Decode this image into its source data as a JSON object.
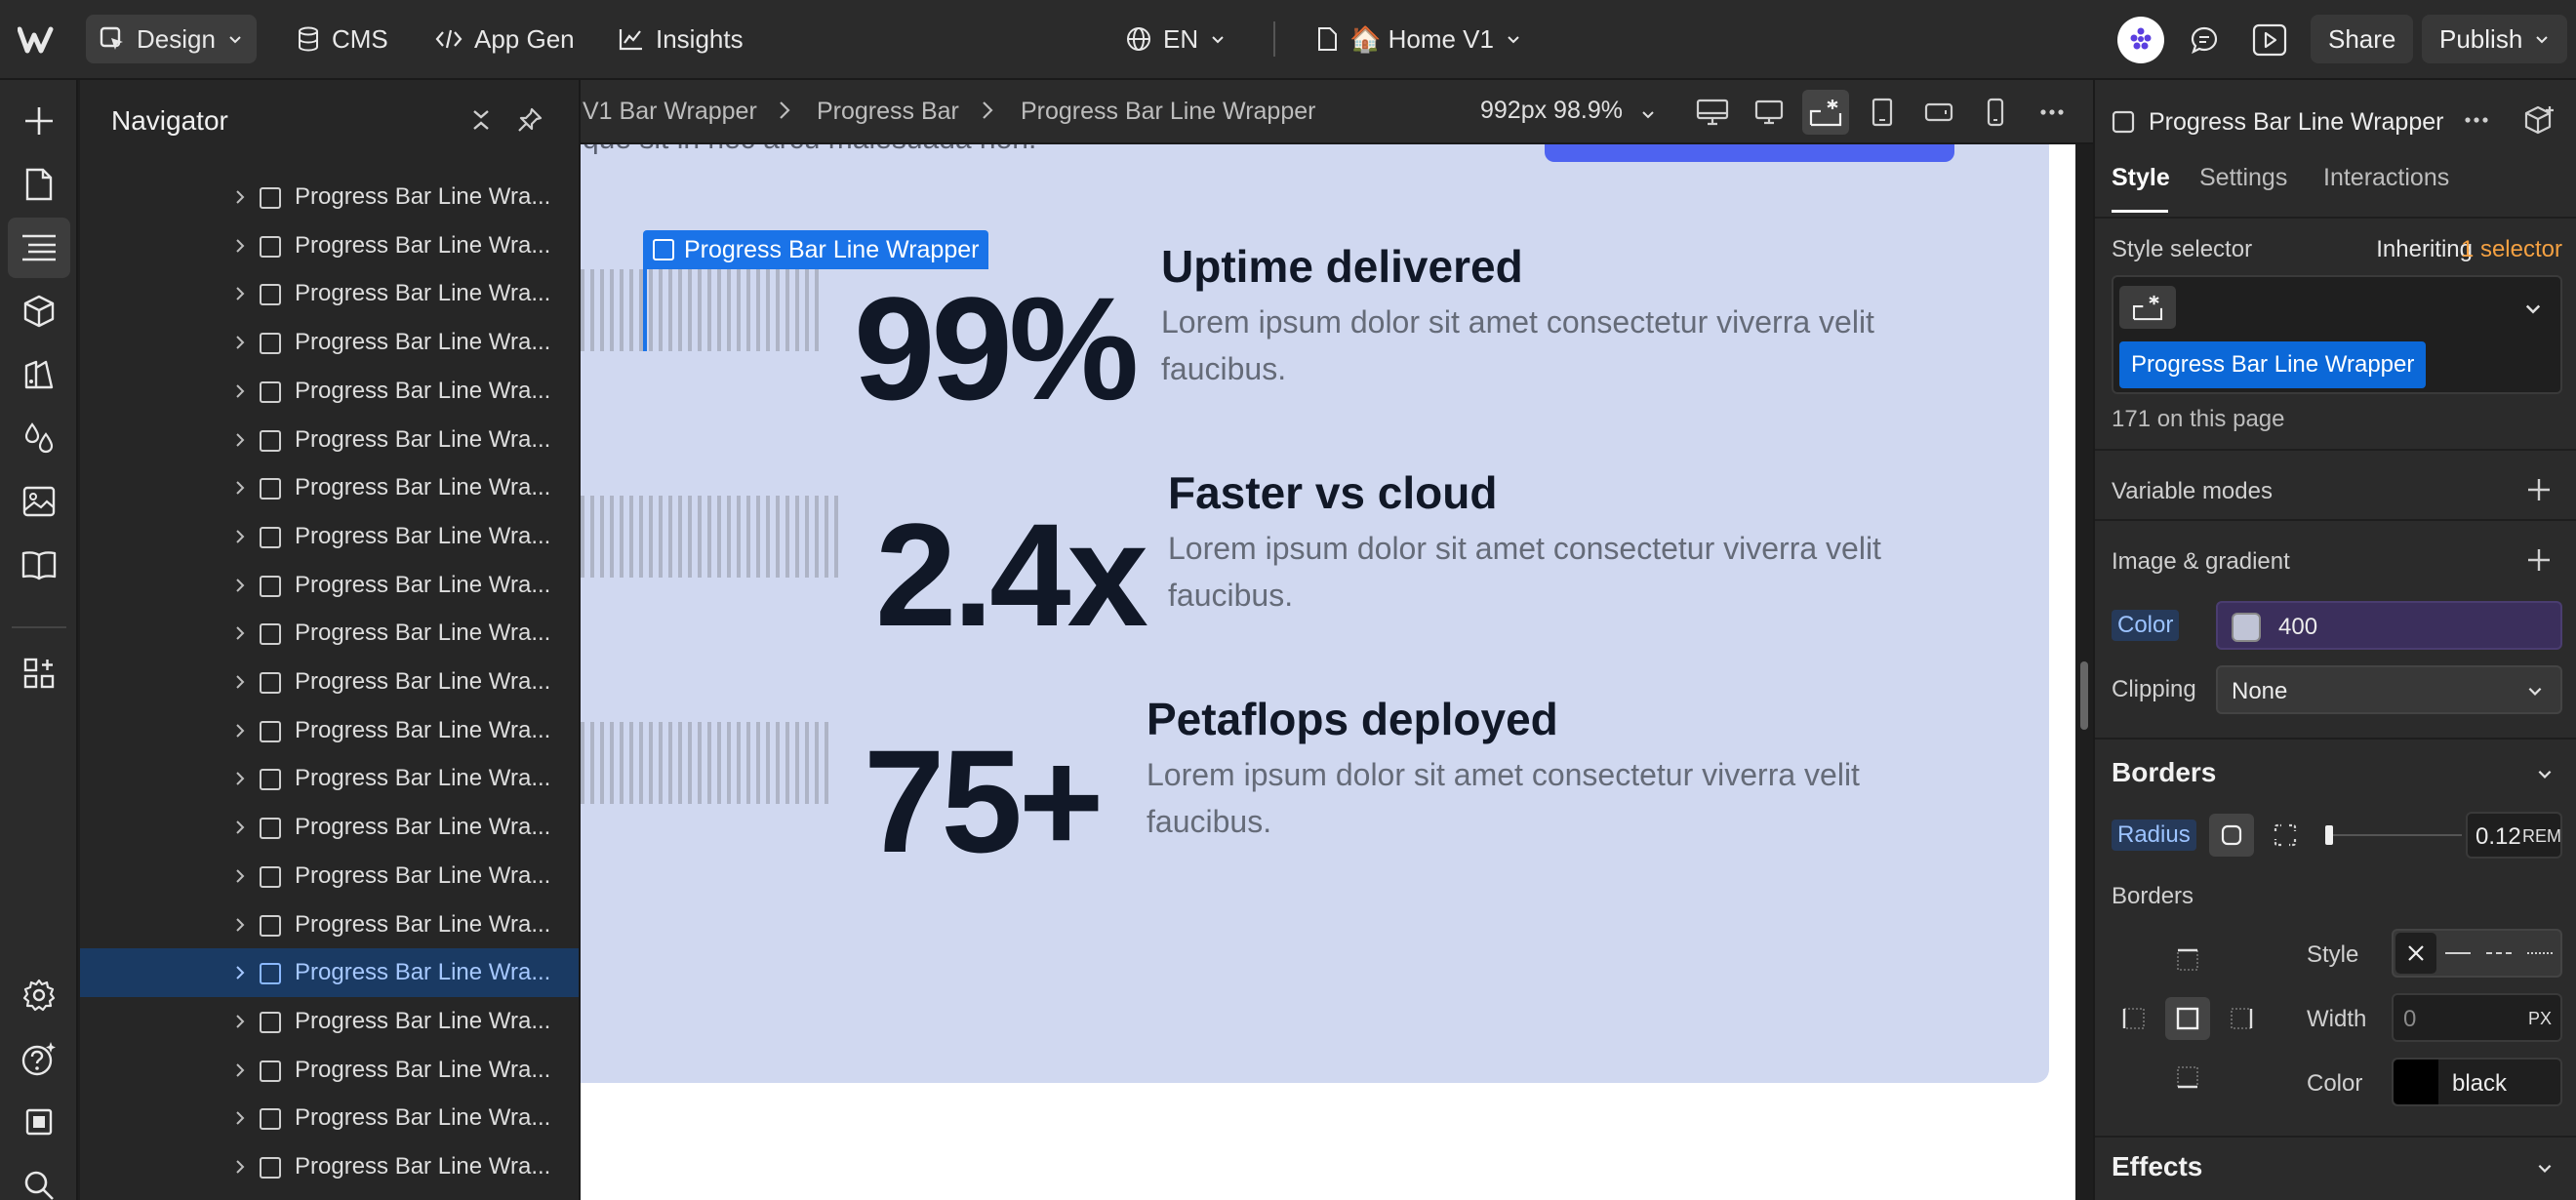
{
  "topbar": {
    "mode": "Design",
    "cms": "CMS",
    "app_gen": "App Gen",
    "insights": "Insights",
    "language": "EN",
    "page_name": "🏠 Home V1",
    "share": "Share",
    "publish": "Publish"
  },
  "navigator": {
    "title": "Navigator",
    "items": [
      "Progress Bar Line Wra...",
      "Progress Bar Line Wra...",
      "Progress Bar Line Wra...",
      "Progress Bar Line Wra...",
      "Progress Bar Line Wra...",
      "Progress Bar Line Wra...",
      "Progress Bar Line Wra...",
      "Progress Bar Line Wra...",
      "Progress Bar Line Wra...",
      "Progress Bar Line Wra...",
      "Progress Bar Line Wra...",
      "Progress Bar Line Wra...",
      "Progress Bar Line Wra...",
      "Progress Bar Line Wra...",
      "Progress Bar Line Wra...",
      "Progress Bar Line Wra...",
      "Progress Bar Line Wra...",
      "Progress Bar Line Wra...",
      "Progress Bar Line Wra...",
      "Progress Bar Line Wra...",
      "Progress Bar Line Wra..."
    ],
    "selected_index": 16
  },
  "canvas": {
    "breadcrumbs": [
      "V1 Bar Wrapper",
      "Progress Bar",
      "Progress Bar Line Wrapper"
    ],
    "breakpoint_info": "992px 98.9%",
    "cut_text": "que sit in nec arcu malesuada non.",
    "selected_label": "Progress Bar Line Wrapper",
    "stats": [
      {
        "number": "99%",
        "title": "Uptime delivered",
        "desc": "Lorem ipsum dolor sit amet consectetur viverra velit faucibus."
      },
      {
        "number": "2.4x",
        "title": "Faster vs cloud",
        "desc": "Lorem ipsum dolor sit amet consectetur viverra velit faucibus."
      },
      {
        "number": "75+",
        "title": "Petaflops deployed",
        "desc": "Lorem ipsum dolor sit amet consectetur viverra velit faucibus."
      }
    ]
  },
  "panel": {
    "element_name": "Progress Bar Line Wrapper",
    "tabs": [
      "Style",
      "Settings",
      "Interactions"
    ],
    "style_selector_label": "Style selector",
    "inheriting": "Inheriting",
    "inheriting_count": "1 selector",
    "class_chip": "Progress Bar Line Wrapper",
    "on_page": "171 on this page",
    "variable_modes": "Variable modes",
    "image_gradient": "Image & gradient",
    "color_label": "Color",
    "color_value": "400",
    "clipping_label": "Clipping",
    "clipping_value": "None",
    "borders_heading": "Borders",
    "radius_label": "Radius",
    "radius_value": "0.12",
    "radius_unit": "REM",
    "borders_sub": "Borders",
    "style_label": "Style",
    "width_label": "Width",
    "width_value": "0",
    "width_unit": "PX",
    "border_color_label": "Color",
    "border_color_value": "black",
    "effects_heading": "Effects"
  },
  "colors": {
    "accent": "#1a73e8",
    "section_bg": "#d0d8f0",
    "swatch_400": "#c0c4d6",
    "variable_bg": "#3b2f5c",
    "inherit_orange": "#f5a142"
  }
}
